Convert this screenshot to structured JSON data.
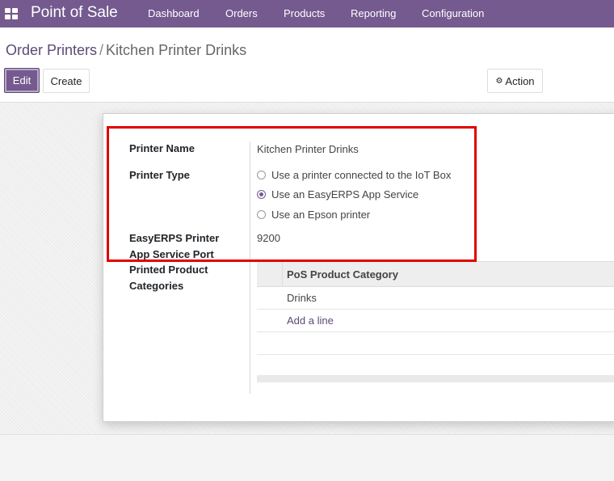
{
  "navbar": {
    "app_name": "Point of Sale",
    "menu": [
      "Dashboard",
      "Orders",
      "Products",
      "Reporting",
      "Configuration"
    ]
  },
  "breadcrumb": {
    "parent": "Order Printers",
    "separator": "/",
    "current": "Kitchen Printer Drinks"
  },
  "toolbar": {
    "edit_label": "Edit",
    "create_label": "Create",
    "action_label": "Action"
  },
  "form": {
    "printer_name_label": "Printer Name",
    "printer_name_value": "Kitchen Printer Drinks",
    "printer_type_label": "Printer Type",
    "printer_type_options": [
      {
        "label": "Use a printer connected to the IoT Box",
        "checked": false
      },
      {
        "label": "Use an EasyERPS App Service",
        "checked": true
      },
      {
        "label": "Use an Epson printer",
        "checked": false
      }
    ],
    "port_label_line1": "EasyERPS Printer",
    "port_label_line2": "App Service Port",
    "port_value": "9200",
    "categories_label_line1": "Printed Product",
    "categories_label_line2": "Categories",
    "categories_table": {
      "column_header": "PoS Product Category",
      "rows": [
        "Drinks"
      ],
      "add_line_label": "Add a line"
    }
  },
  "colors": {
    "brand": "#745a8f",
    "highlight": "#e10000"
  }
}
